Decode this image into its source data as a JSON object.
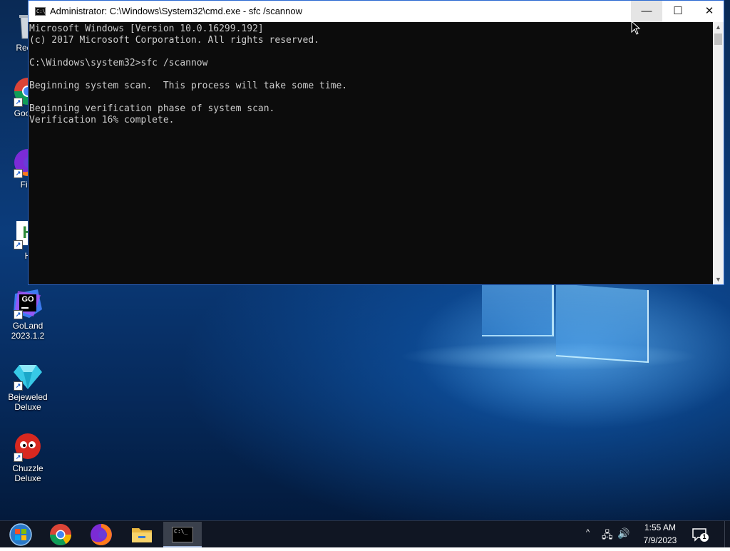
{
  "window": {
    "title": "Administrator: C:\\Windows\\System32\\cmd.exe - sfc  /scannow",
    "icon_text": "C:\\",
    "controls": {
      "minimize_glyph": "—",
      "maximize_glyph": "☐",
      "close_glyph": "✕"
    }
  },
  "console": {
    "lines": [
      "Microsoft Windows [Version 10.0.16299.192]",
      "(c) 2017 Microsoft Corporation. All rights reserved.",
      "",
      "C:\\Windows\\system32>sfc /scannow",
      "",
      "Beginning system scan.  This process will take some time.",
      "",
      "Beginning verification phase of system scan.",
      "Verification 16% complete."
    ],
    "scroll_up_glyph": "▲",
    "scroll_down_glyph": "▼"
  },
  "desktop": {
    "icons": [
      {
        "label": "Recyc",
        "icon": "recycle-bin-icon"
      },
      {
        "label": "Google",
        "icon": "chrome-icon"
      },
      {
        "label": "Fire",
        "icon": "firefox-icon"
      },
      {
        "label": "H",
        "icon": "hxd-icon",
        "glyph": "H"
      },
      {
        "label": "GoLand 2023.1.2",
        "label_line1": "GoLand",
        "label_line2": "2023.1.2",
        "icon": "goland-icon",
        "glyph": "GO"
      },
      {
        "label": "Bejeweled Deluxe",
        "label_line1": "Bejeweled",
        "label_line2": "Deluxe",
        "icon": "bejeweled-icon"
      },
      {
        "label": "Chuzzle Deluxe",
        "icon": "chuzzle-icon"
      }
    ],
    "shortcut_glyph": "↗"
  },
  "taskbar": {
    "items": [
      {
        "name": "start-button",
        "icon": "windows-orb-icon"
      },
      {
        "name": "chrome",
        "icon": "chrome-icon"
      },
      {
        "name": "firefox",
        "icon": "firefox-icon"
      },
      {
        "name": "file-explorer",
        "icon": "folder-icon"
      },
      {
        "name": "command-prompt",
        "icon": "cmd-icon",
        "active": true,
        "glyph": "C:\\_"
      }
    ],
    "tray": {
      "chevron": "^",
      "network_glyph": "🖧",
      "volume_glyph": "🔊",
      "time": "1:55 AM",
      "date": "7/9/2023",
      "notification_count": "1"
    }
  },
  "colors": {
    "console_bg": "#0c0c0c",
    "console_text": "#cccccc",
    "accent_border": "#2b6ad1",
    "taskbar_bg": "#101623"
  }
}
